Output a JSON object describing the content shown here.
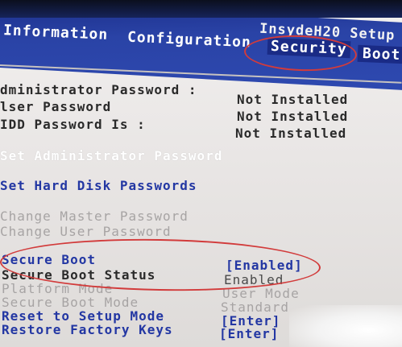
{
  "brand": "InsydeH20 Setup",
  "tabs": [
    {
      "label": "Information"
    },
    {
      "label": "Configuration"
    },
    {
      "label": "Security"
    },
    {
      "label": "Boot"
    }
  ],
  "info_rows": [
    {
      "label": "dministrator Password :",
      "value": "Not Installed"
    },
    {
      "label": "lser Password",
      "value": "Not Installed"
    },
    {
      "label": "IDD Password Is :",
      "value": "Not Installed"
    }
  ],
  "actions": [
    {
      "label": "Set Administrator Password"
    },
    {
      "label": "Set Hard Disk Passwords"
    },
    {
      "label": "Change Master Password"
    },
    {
      "label": "Change User Password"
    }
  ],
  "boot_rows": [
    {
      "label": "Secure Boot",
      "value": "[Enabled]"
    },
    {
      "label": "Secure Boot Status",
      "value": "Enabled"
    },
    {
      "label": "Platform Mode",
      "value": "User Mode"
    },
    {
      "label": "Secure Boot Mode",
      "value": "Standard"
    },
    {
      "label": "Reset to Setup Mode",
      "value": "[Enter]"
    },
    {
      "label": "Restore Factory Keys",
      "value": "[Enter]"
    }
  ],
  "colors": {
    "menubar": "#2e49b0",
    "highlight_tab": "#1a2b86",
    "annotation_circle": "#d23b3b",
    "label_blue": "#2337a3"
  }
}
